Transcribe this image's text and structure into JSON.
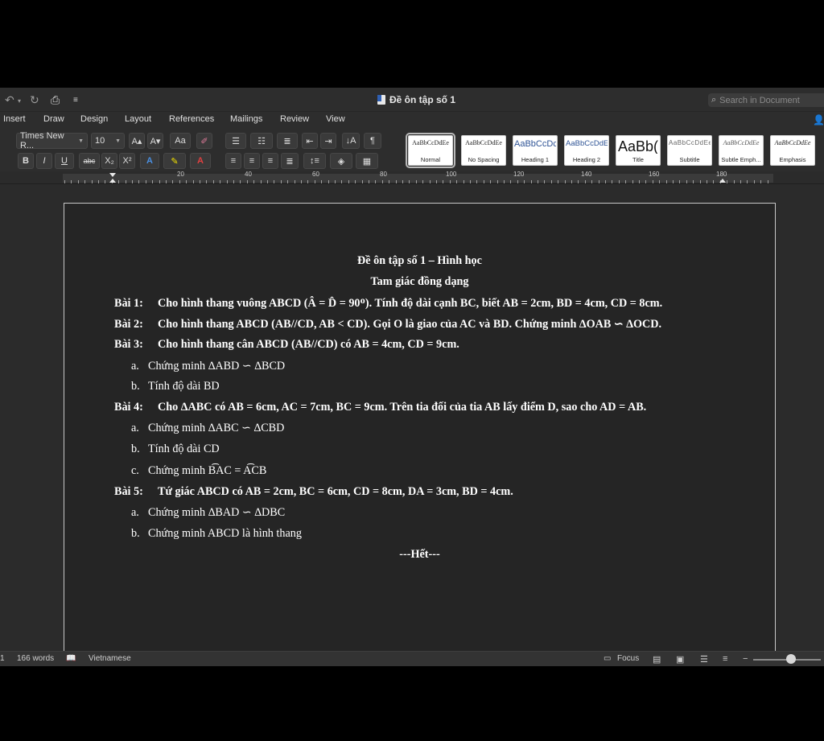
{
  "window": {
    "title": "Đề ôn tập số 1"
  },
  "search": {
    "placeholder": "Search in Document"
  },
  "tabs": [
    "Insert",
    "Draw",
    "Design",
    "Layout",
    "References",
    "Mailings",
    "Review",
    "View"
  ],
  "ribbon": {
    "font_name": "Times New R...",
    "font_size": "10",
    "bold": "B",
    "italic": "I",
    "underline": "U",
    "strike": "abc",
    "subscript": "X₂",
    "superscript": "X²",
    "font_grow": "A▴",
    "font_shrink": "A▾",
    "change_case": "Aa",
    "text_effects": "A",
    "highlight": "✎",
    "font_color": "A",
    "pilcrow": "¶",
    "sort": "↓A"
  },
  "styles": [
    {
      "preview": "AaBbCcDdEe",
      "name": "Normal",
      "selected": true
    },
    {
      "preview": "AaBbCcDdEe",
      "name": "No Spacing"
    },
    {
      "preview": "AaBbCcDc",
      "name": "Heading 1"
    },
    {
      "preview": "AaBbCcDdEe",
      "name": "Heading 2"
    },
    {
      "preview": "AaBb(",
      "name": "Title"
    },
    {
      "preview": "AaBbCcDdEe",
      "name": "Subtitle"
    },
    {
      "preview": "AaBbCcDdEe",
      "name": "Subtle Emph..."
    },
    {
      "preview": "AaBbCcDdEe",
      "name": "Emphasis"
    }
  ],
  "ruler_labels": [
    "20",
    "40",
    "60",
    "80",
    "100",
    "120",
    "140",
    "160",
    "180"
  ],
  "document": {
    "title": "Đề ôn tập số 1 – Hình học",
    "subtitle": "Tam giác đồng dạng",
    "exercises": [
      {
        "label": "Bài 1:",
        "text": "Cho hình thang vuông ABCD (Â = D̂ = 90ᴼ). Tính độ dài cạnh BC, biết AB = 2cm, BD = 4cm, CD = 8cm.",
        "items": []
      },
      {
        "label": "Bài 2:",
        "text": "Cho hình thang ABCD (AB//CD, AB < CD). Gọi O là giao của AC và BD. Chứng minh ∆OAB ∽ ∆OCD.",
        "items": []
      },
      {
        "label": "Bài 3:",
        "text": "Cho hình thang cân ABCD (AB//CD) có AB = 4cm, CD = 9cm.",
        "items": [
          {
            "label": "a.",
            "text": "Chứng minh ∆ABD ∽ ∆BCD"
          },
          {
            "label": "b.",
            "text": "Tính độ dài BD"
          }
        ]
      },
      {
        "label": "Bài 4:",
        "text": "Cho ∆ABC có AB = 6cm, AC = 7cm, BC = 9cm. Trên tia đối của tia AB lấy điểm D, sao cho AD = AB.",
        "items": [
          {
            "label": "a.",
            "text": "Chứng minh ∆ABC ∽ ∆CBD"
          },
          {
            "label": "b.",
            "text": "Tính độ dài CD"
          },
          {
            "label": "c.",
            "text": "Chứng minh B͡AC = A͡CB"
          }
        ]
      },
      {
        "label": "Bài 5:",
        "text": "Tứ giác ABCD có AB = 2cm, BC = 6cm, CD = 8cm, DA = 3cm, BD = 4cm.",
        "items": [
          {
            "label": "a.",
            "text": "Chứng minh ∆BAD ∽ ∆DBC"
          },
          {
            "label": "b.",
            "text": "Chứng minh ABCD là hình thang"
          }
        ]
      }
    ],
    "end": "---Hết---"
  },
  "status": {
    "page": "1",
    "words": "166 words",
    "language": "Vietnamese",
    "focus": "Focus"
  }
}
